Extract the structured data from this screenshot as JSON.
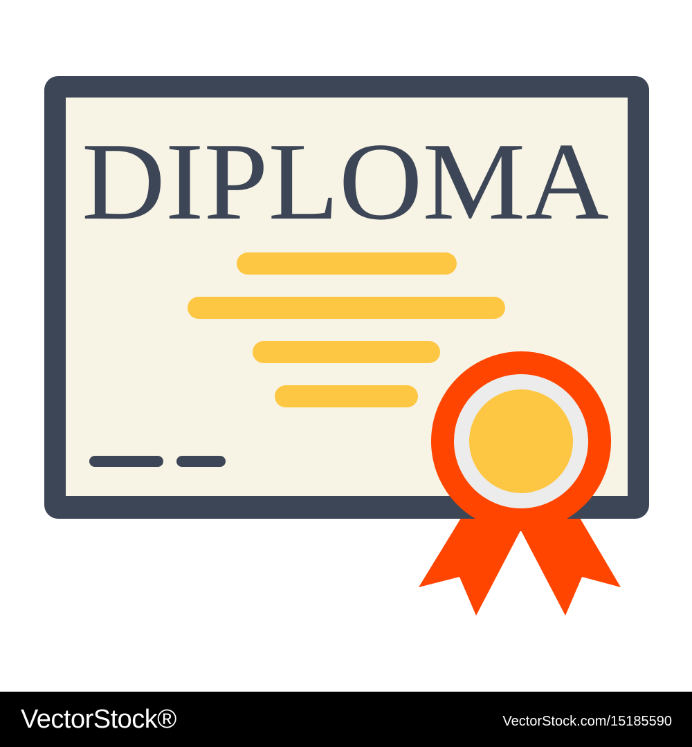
{
  "certificate": {
    "title": "DIPLOMA",
    "colors": {
      "frame": "#3d4656",
      "paper": "#f8f4e5",
      "text_lines": "#fdc743",
      "signature": "#3d4656",
      "rosette_outer": "#ff4500",
      "rosette_ring": "#ececec",
      "rosette_center": "#fdc743",
      "ribbon": "#ff4500"
    },
    "icons": [
      "certificate-icon",
      "award-rosette-icon",
      "ribbon-icon"
    ]
  },
  "watermark": {
    "logo": "VectorStock®",
    "image_id": "VectorStock.com/15185590",
    "colors": {
      "bar": "#000000",
      "text": "#ffffff"
    }
  }
}
